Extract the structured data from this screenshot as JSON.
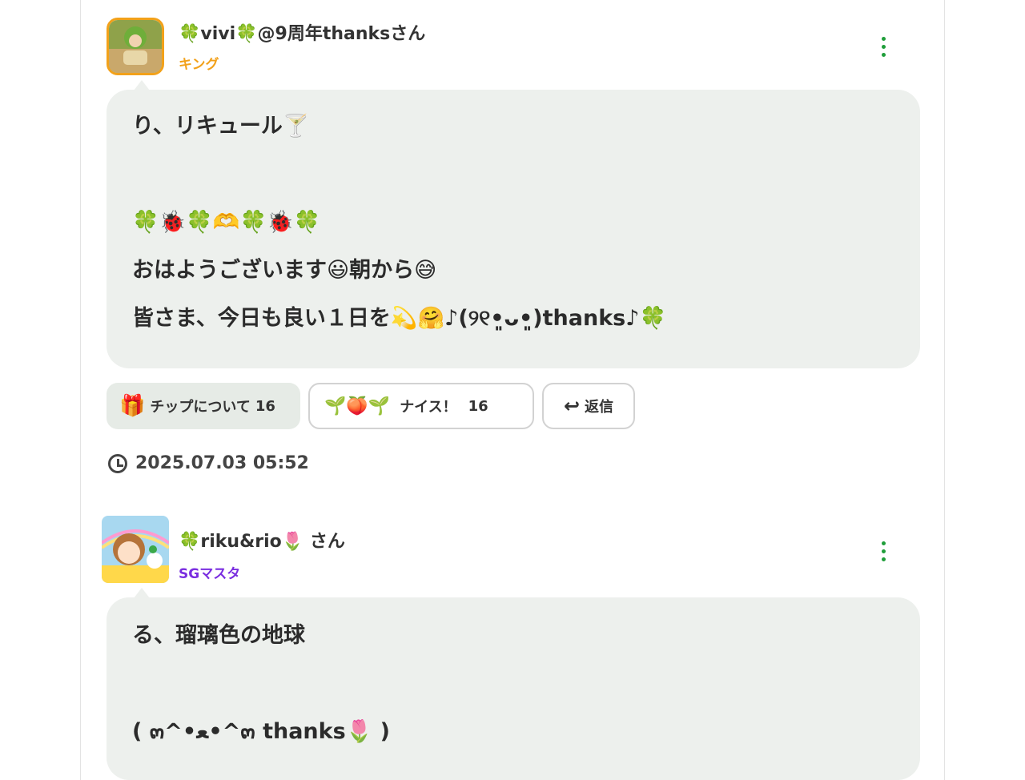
{
  "posts": [
    {
      "username": "🍀vivi🍀@9周年thanksさん",
      "rank": "キング",
      "rank_color": "#f2a11a",
      "lines": [
        "り、リキュール🍸",
        "",
        "🍀🐞🍀🫶🍀🐞🍀",
        "おはようございます😃朝から😅",
        "皆さま、今日も良い１日を💫🤗♪(୨୧•͈ᴗ•͈)thanks♪🍀"
      ],
      "tip_label": "チップについて",
      "tip_count": "16",
      "nice_stamps": "🌱🍑🌱",
      "nice_label": "ナイス！",
      "nice_count": "16",
      "reply_label": "返信",
      "timestamp": "2025.07.03 05:52"
    },
    {
      "username": "🍀riku&rio🌷 さん",
      "rank": "SGマスタ",
      "rank_color": "#7a2ee0",
      "lines": [
        "る、瑠璃色の地球",
        "",
        "( ๓^•ﻌ•^๓ thanks🌷 )"
      ]
    }
  ],
  "colors": {
    "accent_green": "#1f9e3a",
    "bubble_bg": "#edf0ed"
  }
}
